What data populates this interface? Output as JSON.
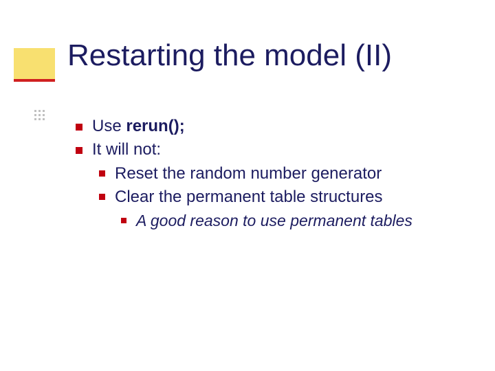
{
  "title": "Restarting the model (II)",
  "bullets": {
    "b1_pre": "Use ",
    "b1_bold": "rerun();",
    "b2": "It will not:",
    "b2a": "Reset the random number generator",
    "b2b": "Clear the permanent table structures",
    "b2b1": "A good reason to use permanent tables"
  }
}
